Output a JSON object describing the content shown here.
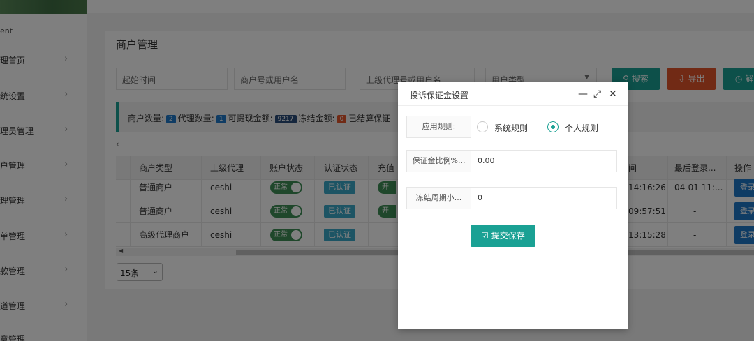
{
  "sidebar": {
    "brand": "ent",
    "items": [
      {
        "label": "理首页"
      },
      {
        "label": "统设置"
      },
      {
        "label": "理员管理"
      },
      {
        "label": "户管理"
      },
      {
        "label": "理管理"
      },
      {
        "label": "单管理"
      },
      {
        "label": "款管理"
      },
      {
        "label": "道管理"
      },
      {
        "label": "意管理"
      }
    ]
  },
  "page": {
    "title": "商户管理"
  },
  "filters": {
    "start_time": "起始时间",
    "merchant_no": "商户号或用户名",
    "parent_agent": "上级代理号或用户名",
    "user_type": "用户类型"
  },
  "buttons": {
    "search": "搜索",
    "export": "导出",
    "third": "解"
  },
  "stats": {
    "merchant_count_label": "商户数量:",
    "merchant_count": "2",
    "agent_count_label": "代理数量:",
    "agent_count": "1",
    "withdrawable_label": "可提现金额:",
    "withdrawable": "9217",
    "frozen_label": "冻结金额:",
    "frozen": "0",
    "settled_label": "已结算保证"
  },
  "table": {
    "headers": [
      "商户类型",
      "上级代理",
      "账户状态",
      "认证状态",
      "充值",
      "间",
      "最后登录...",
      "操作"
    ],
    "rows": [
      {
        "type": "普通商户",
        "agent": "ceshi",
        "status": "正常",
        "cert": "已认证",
        "recharge": "开",
        "time": "14:16:26",
        "last_login": "04-01 11:...",
        "action": "登录"
      },
      {
        "type": "普通商户",
        "agent": "ceshi",
        "status": "正常",
        "cert": "已认证",
        "recharge": "开",
        "time": "09:57:51",
        "last_login": "-",
        "action": "登录"
      },
      {
        "type": "高级代理商户",
        "agent": "ceshi",
        "status": "正常",
        "cert": "已认证",
        "recharge": "",
        "time": "13:15:28",
        "last_login": "-",
        "action": "登录"
      }
    ]
  },
  "pagination": {
    "page_size": "15条"
  },
  "dialog": {
    "title": "投诉保证金设置",
    "rule_label": "应用规则:",
    "rule_options": [
      "系统规则",
      "个人规则"
    ],
    "rule_selected": "个人规则",
    "ratio_label": "保证金比例%...",
    "ratio_value": "0.00",
    "freeze_label": "冻结周期小...",
    "freeze_value": "0",
    "submit_label": "提交保存"
  },
  "colors": {
    "accent": "#1aa194",
    "export": "#e3552b",
    "badge_blue": "#1e78c8",
    "badge_navy": "#2a4d7a",
    "badge_red": "#e3552b",
    "toggle_green": "#3f8f57",
    "cert_blue": "#3aa9c9"
  }
}
